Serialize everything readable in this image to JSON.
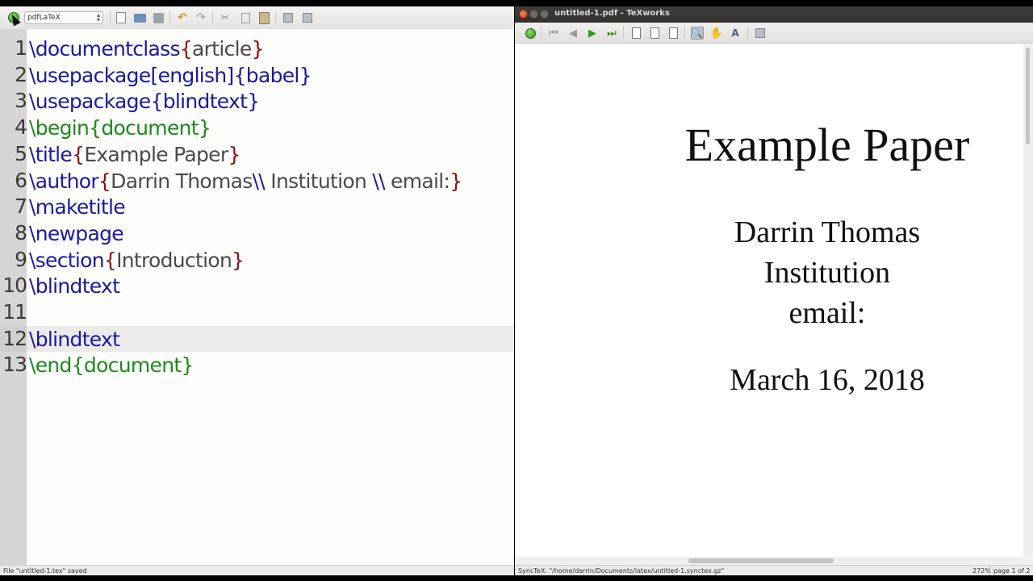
{
  "editor": {
    "engine": "pdfLaTeX",
    "status": "File \"untitled-1.tex\" saved",
    "line_numbers": [
      "1",
      "2",
      "3",
      "4",
      "5",
      "6",
      "7",
      "8",
      "9",
      "10",
      "11",
      "12",
      "13"
    ],
    "lines": [
      [
        {
          "t": "\\documentclass",
          "c": "cmd"
        },
        {
          "t": "{",
          "c": "brace"
        },
        {
          "t": "article",
          "c": "arg"
        },
        {
          "t": "}",
          "c": "brace"
        }
      ],
      [
        {
          "t": "\\usepackage[english]{babel}",
          "c": "cmd"
        }
      ],
      [
        {
          "t": "\\usepackage{blindtext}",
          "c": "cmd"
        }
      ],
      [
        {
          "t": "\\begin{document}",
          "c": "env"
        }
      ],
      [
        {
          "t": "\\title",
          "c": "cmd"
        },
        {
          "t": "{",
          "c": "brace"
        },
        {
          "t": "Example Paper",
          "c": "arg"
        },
        {
          "t": "}",
          "c": "brace"
        }
      ],
      [
        {
          "t": "\\author",
          "c": "cmd"
        },
        {
          "t": "{",
          "c": "brace"
        },
        {
          "t": "Darrin Thomas",
          "c": "arg"
        },
        {
          "t": "\\\\",
          "c": "cmd"
        },
        {
          "t": " Institution ",
          "c": "arg"
        },
        {
          "t": "\\\\",
          "c": "cmd"
        },
        {
          "t": " email:",
          "c": "arg"
        },
        {
          "t": "}",
          "c": "brace"
        }
      ],
      [
        {
          "t": "\\maketitle",
          "c": "cmd"
        }
      ],
      [
        {
          "t": "\\newpage",
          "c": "cmd"
        }
      ],
      [
        {
          "t": "\\section",
          "c": "cmd"
        },
        {
          "t": "{",
          "c": "brace"
        },
        {
          "t": "Introduction",
          "c": "arg"
        },
        {
          "t": "}",
          "c": "brace"
        }
      ],
      [
        {
          "t": "\\blindtext",
          "c": "cmd"
        }
      ],
      [],
      [
        {
          "t": "\\blindtext",
          "c": "cmd"
        }
      ],
      [
        {
          "t": "\\end{document}",
          "c": "env"
        }
      ]
    ],
    "current_line": 12
  },
  "preview": {
    "window_title": "untitled-1.pdf - TeXworks",
    "pdf": {
      "title": "Example Paper",
      "author_lines": [
        "Darrin Thomas",
        "Institution",
        "email:"
      ],
      "date": "March 16, 2018"
    },
    "synctex_message": "SyncTeX: \"/home/darrin/Documents/latex/untitled-1.synctex.gz\"",
    "zoom": "272%",
    "page": "page 1 of 2"
  },
  "colors": {
    "command": "#1a1aa0",
    "brace": "#8b1010",
    "argument": "#4a4a4a",
    "environment": "#1c8a1c"
  }
}
